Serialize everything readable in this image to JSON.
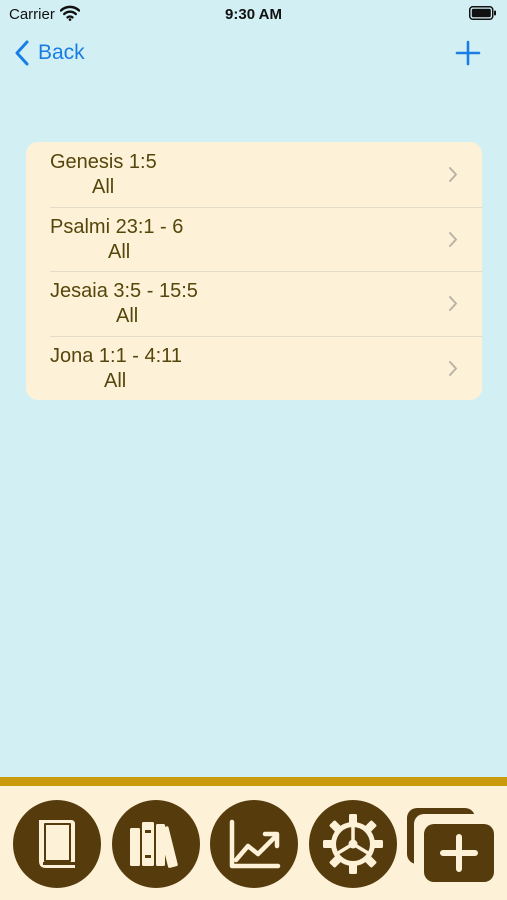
{
  "status_bar": {
    "carrier": "Carrier",
    "time": "9:30 AM"
  },
  "nav": {
    "back_label": "Back",
    "back_icon": "chevron-left-icon",
    "add_icon": "plus-icon"
  },
  "readings": [
    {
      "reference": "Genesis 1:5",
      "scope": "All",
      "scope_indent": 42
    },
    {
      "reference": "Psalmi 23:1 - 6",
      "scope": "All",
      "scope_indent": 58
    },
    {
      "reference": "Jesaia 3:5 - 15:5",
      "scope": "All",
      "scope_indent": 66
    },
    {
      "reference": "Jona 1:1 - 4:11",
      "scope": "All",
      "scope_indent": 54
    }
  ],
  "tab_bar": {
    "items": [
      {
        "icon": "book-icon"
      },
      {
        "icon": "library-icon"
      },
      {
        "icon": "stats-chart-icon"
      },
      {
        "icon": "settings-gear-icon"
      },
      {
        "icon": "new-plan-icon"
      }
    ]
  },
  "colors": {
    "background": "#d2f0f4",
    "accent": "#1a7de6",
    "card": "#fdf1d8",
    "text": "#55460b",
    "brand_dark": "#563c0d",
    "brand_gold": "#c99a0b"
  }
}
